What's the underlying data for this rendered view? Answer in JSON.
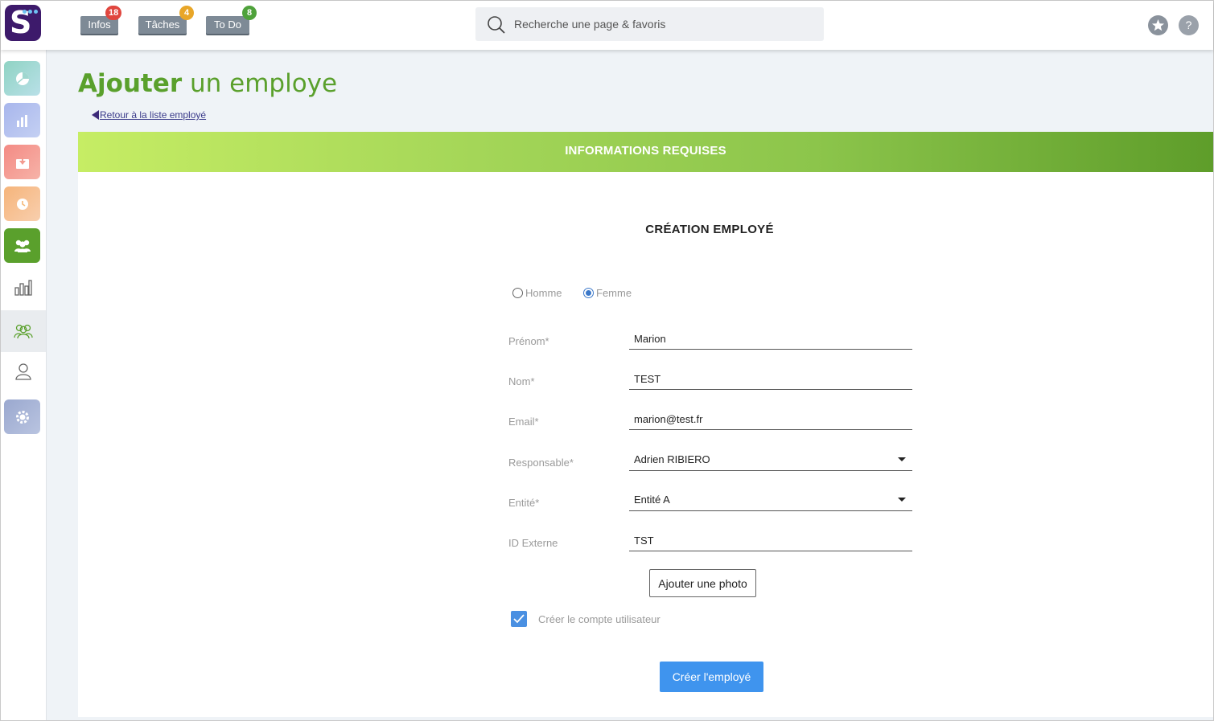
{
  "app": {
    "logo_letter": "S"
  },
  "topbar": {
    "tabs": [
      {
        "label": "Infos",
        "badge": "18",
        "badge_color": "#e0463e"
      },
      {
        "label": "Tâches",
        "badge": "4",
        "badge_color": "#e8a628"
      },
      {
        "label": "To Do",
        "badge": "8",
        "badge_color": "#4fa23b"
      }
    ],
    "search": {
      "placeholder": "Recherche une page & favoris",
      "value": ""
    },
    "favorites_icon": "star-icon",
    "help_label": "?"
  },
  "sidebar": {
    "items": [
      {
        "name": "dashboard",
        "icon": "pie-icon",
        "color": "#7fcfc6"
      },
      {
        "name": "stats",
        "icon": "bar-chart-icon",
        "color": "#9aaee8"
      },
      {
        "name": "inbox",
        "icon": "download-box-icon",
        "color": "#f08a82"
      },
      {
        "name": "time",
        "icon": "clock-icon",
        "color": "#f5b878"
      },
      {
        "name": "team",
        "icon": "team-icon",
        "color": "#5aa02c"
      },
      {
        "name": "analytics",
        "icon": "bars-outline-icon"
      },
      {
        "name": "employees",
        "icon": "users-outline-icon",
        "active": true
      },
      {
        "name": "profile",
        "icon": "user-outline-icon"
      },
      {
        "name": "settings",
        "icon": "gear-icon",
        "color": "#9aa8c8"
      }
    ]
  },
  "page": {
    "title_strong": "Ajouter",
    "title_light": "un employe",
    "back_link": "Retour à la liste employé"
  },
  "card": {
    "header": "INFORMATIONS REQUISES",
    "form_title": "CRÉATION EMPLOYÉ",
    "gender": {
      "options": [
        "Homme",
        "Femme"
      ],
      "selected": "Femme"
    },
    "fields": {
      "prenom": {
        "label": "Prénom*",
        "value": "Marion"
      },
      "nom": {
        "label": "Nom*",
        "value": "TEST"
      },
      "email": {
        "label": "Email*",
        "value": "marion@test.fr"
      },
      "responsable": {
        "label": "Responsable*",
        "value": "Adrien RIBIERO"
      },
      "entite": {
        "label": "Entité*",
        "value": "Entité A"
      },
      "id_externe": {
        "label": "ID Externe",
        "value": "TST"
      }
    },
    "photo_button": "Ajouter une photo",
    "create_account": {
      "label": "Créer le compte utilisateur",
      "checked": true
    },
    "submit_button": "Créer l'employé"
  },
  "colors": {
    "brand_green": "#5aa02c",
    "primary_blue": "#3f94ee",
    "logo_purple": "#3d1a6b"
  }
}
